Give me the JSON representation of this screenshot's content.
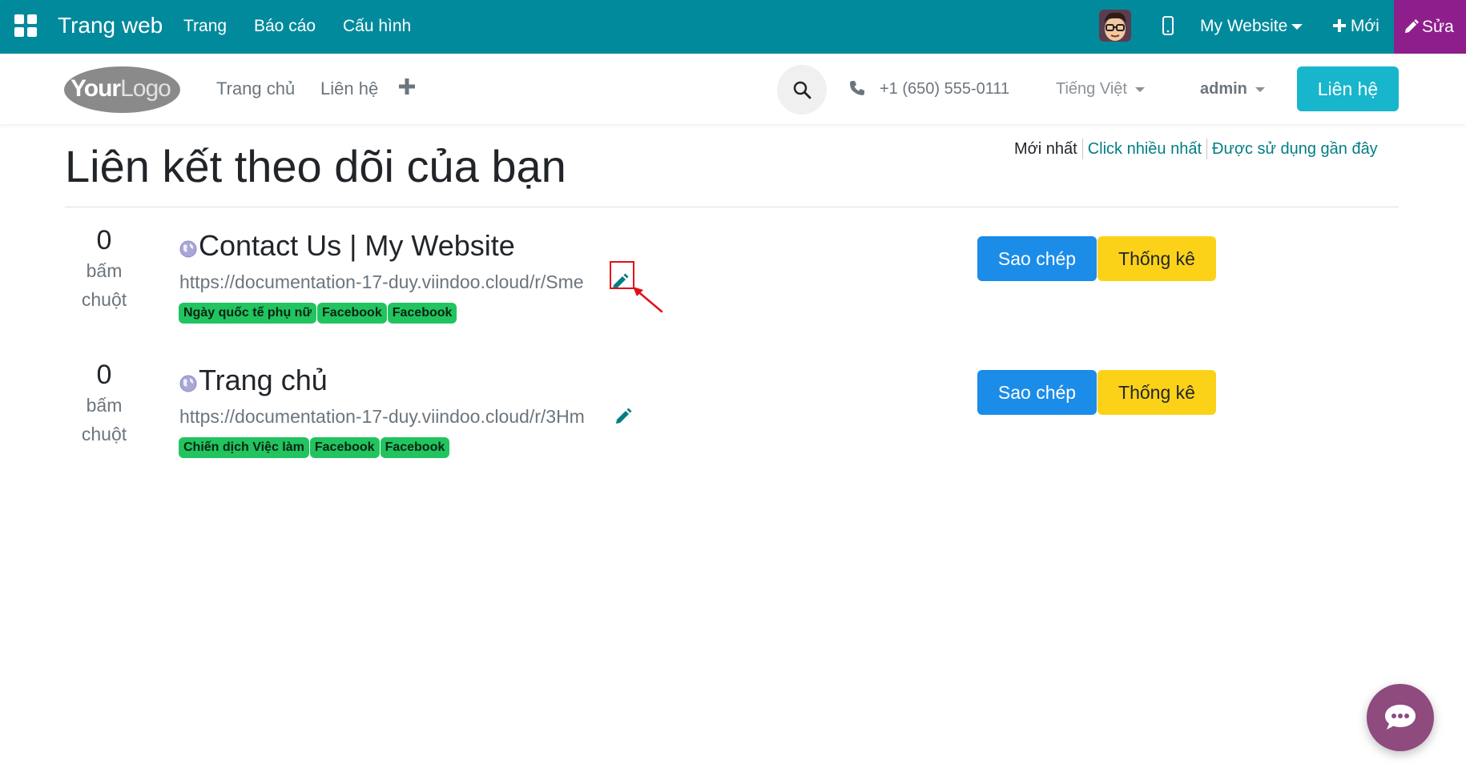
{
  "admin_bar": {
    "brand": "Trang web",
    "menu": [
      "Trang",
      "Báo cáo",
      "Cấu hình"
    ],
    "website_selector": "My Website",
    "new_label": "Mới",
    "edit_label": "Sửa",
    "bg_color": "#018a9c",
    "edit_color": "#8f1e8d"
  },
  "header": {
    "logo": {
      "part1": "Your",
      "part2": "Logo"
    },
    "nav": [
      "Trang chủ",
      "Liên hệ"
    ],
    "add_icon": "plus-icon",
    "phone": "+1 (650) 555-0111",
    "language": "Tiếng Việt",
    "user": "admin",
    "contact_button": "Liên hệ",
    "contact_color": "#17b6cc"
  },
  "page": {
    "title": "Liên kết theo dõi của bạn",
    "sort": {
      "active": "Mới nhất",
      "options": [
        "Click nhiều nhất",
        "Được sử dụng gần đây"
      ]
    }
  },
  "links": [
    {
      "clicks": "0",
      "clicks_label_1": "bấm",
      "clicks_label_2": "chuột",
      "title": "Contact Us | My Website",
      "url": "https://documentation-17-duy.viindoo.cloud/r/Sme",
      "tags": [
        "Ngày quốc tế phụ nữ",
        "Facebook",
        "Facebook"
      ],
      "copy_label": "Sao chép",
      "stats_label": "Thống kê"
    },
    {
      "clicks": "0",
      "clicks_label_1": "bấm",
      "clicks_label_2": "chuột",
      "title": "Trang chủ",
      "url": "https://documentation-17-duy.viindoo.cloud/r/3Hm",
      "tags": [
        "Chiến dịch Việc làm",
        "Facebook",
        "Facebook"
      ],
      "copy_label": "Sao chép",
      "stats_label": "Thống kê"
    }
  ],
  "colors": {
    "copy_button": "#1b8ce8",
    "stats_button": "#fcd219",
    "tag": "#21c45f",
    "annotation": "#e0101a",
    "chat_button": "#8f4a7e"
  }
}
